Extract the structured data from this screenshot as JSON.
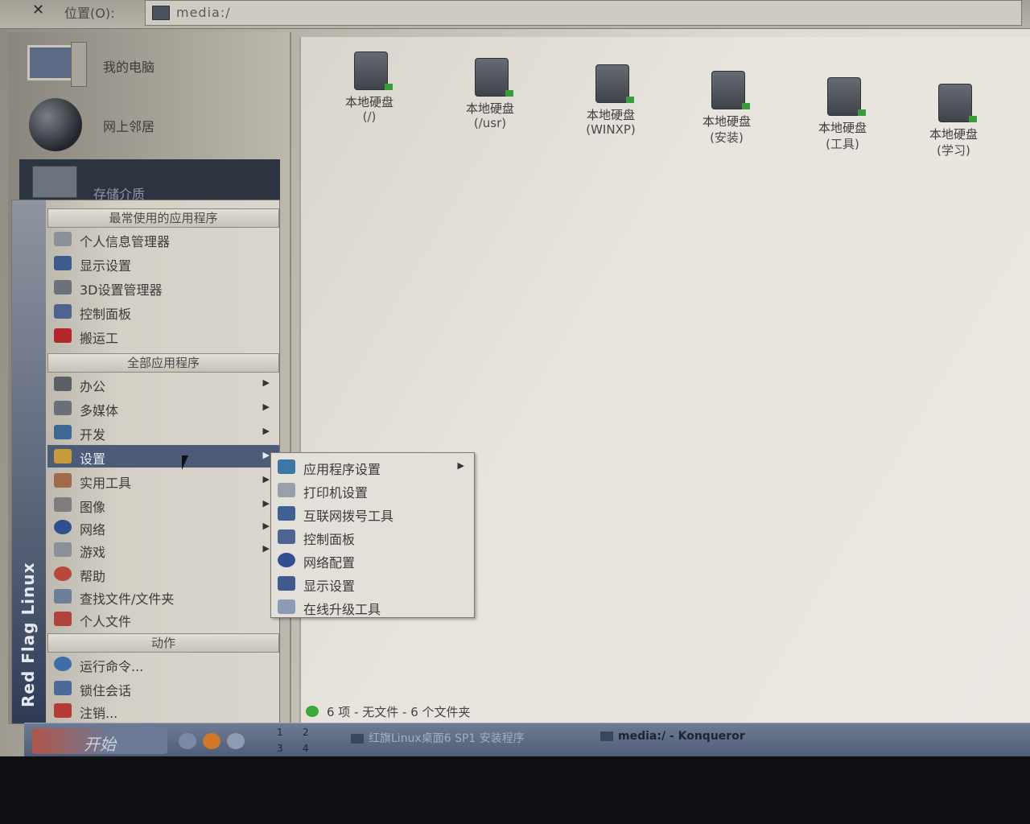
{
  "location_bar": {
    "label": "位置(O):",
    "value": "media:/"
  },
  "sidebar": {
    "devices": [
      {
        "label": "我的电脑",
        "icon": "computer-icon"
      },
      {
        "label": "网上邻居",
        "icon": "globe-icon"
      },
      {
        "label": "存储介质",
        "icon": "storage-icon"
      }
    ]
  },
  "start_menu": {
    "brand_vertical": "Red Flag Linux",
    "section_recent": "最常使用的应用程序",
    "recent_items": [
      {
        "label": "个人信息管理器",
        "icon": "pim-icon"
      },
      {
        "label": "显示设置",
        "icon": "display-icon"
      },
      {
        "label": "3D设置管理器",
        "icon": "3d-icon"
      },
      {
        "label": "控制面板",
        "icon": "control-panel-icon"
      },
      {
        "label": "搬运工",
        "icon": "porter-icon"
      }
    ],
    "section_all": "全部应用程序",
    "all_items": [
      {
        "label": "办公",
        "icon": "office-icon",
        "submenu": true
      },
      {
        "label": "多媒体",
        "icon": "multimedia-icon",
        "submenu": true
      },
      {
        "label": "开发",
        "icon": "dev-icon",
        "submenu": true
      },
      {
        "label": "设置",
        "icon": "wrench-icon",
        "submenu": true,
        "active": true
      },
      {
        "label": "实用工具",
        "icon": "utilities-icon",
        "submenu": true
      },
      {
        "label": "图像",
        "icon": "image-icon",
        "submenu": true
      },
      {
        "label": "网络",
        "icon": "network-icon",
        "submenu": true
      },
      {
        "label": "游戏",
        "icon": "games-icon",
        "submenu": true
      },
      {
        "label": "帮助",
        "icon": "help-icon",
        "submenu": false
      },
      {
        "label": "查找文件/文件夹",
        "icon": "find-icon",
        "submenu": false
      },
      {
        "label": "个人文件",
        "icon": "home-icon",
        "submenu": false
      }
    ],
    "section_actions": "动作",
    "action_items": [
      {
        "label": "运行命令...",
        "icon": "run-icon"
      },
      {
        "label": "锁住会话",
        "icon": "lock-icon"
      },
      {
        "label": "注销...",
        "icon": "logout-icon"
      }
    ]
  },
  "settings_submenu": {
    "items": [
      {
        "label": "应用程序设置",
        "icon": "app-settings-icon",
        "submenu": true
      },
      {
        "label": "打印机设置",
        "icon": "printer-icon",
        "submenu": false
      },
      {
        "label": "互联网拨号工具",
        "icon": "dialup-icon",
        "submenu": false
      },
      {
        "label": "控制面板",
        "icon": "control-panel-icon",
        "submenu": false
      },
      {
        "label": "网络配置",
        "icon": "network-config-icon",
        "submenu": false
      },
      {
        "label": "显示设置",
        "icon": "display-icon",
        "submenu": false
      },
      {
        "label": "在线升级工具",
        "icon": "update-icon",
        "submenu": false
      }
    ]
  },
  "file_view": {
    "drives": [
      {
        "line1": "本地硬盘",
        "line2": "(/)"
      },
      {
        "line1": "本地硬盘",
        "line2": "(/usr)"
      },
      {
        "line1": "本地硬盘",
        "line2": "(WINXP)"
      },
      {
        "line1": "本地硬盘",
        "line2": "(安装)"
      },
      {
        "line1": "本地硬盘",
        "line2": "(工具)"
      },
      {
        "line1": "本地硬盘",
        "line2": "(学习)"
      }
    ],
    "status": "6 项 - 无文件 - 6 个文件夹"
  },
  "taskbar": {
    "start_label": "开始",
    "desktops": [
      "1",
      "2",
      "3",
      "4"
    ],
    "tasks": [
      {
        "label": "红旗Linux桌面6 SP1 安装程序"
      },
      {
        "label": "media:/ - Konqueror"
      }
    ]
  },
  "colors": {
    "menu_highlight": "#4c5b78",
    "taskbar": "#5d6b85",
    "status_green": "#3aa83a"
  }
}
